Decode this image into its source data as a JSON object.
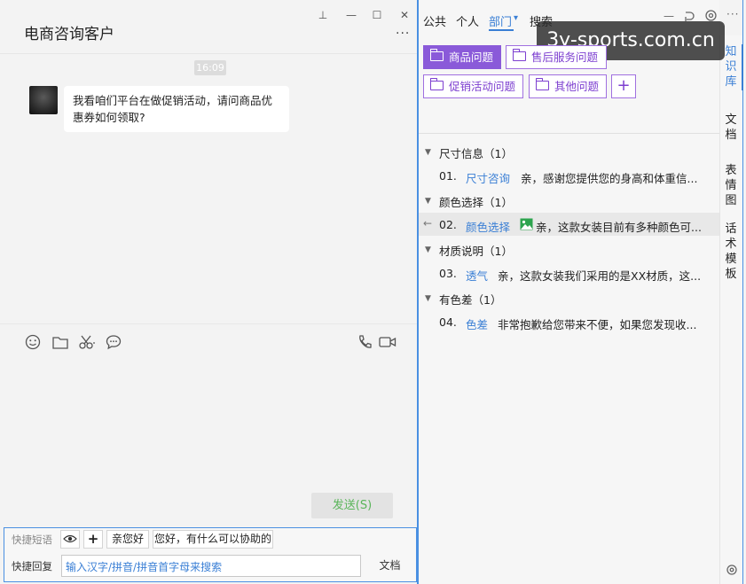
{
  "chat": {
    "title": "电商咨询客户",
    "more": "···",
    "window_buttons": {
      "pin": "⊥",
      "minimize": "—",
      "maximize": "☐",
      "close": "✕"
    },
    "time": "16:09",
    "message": "我看咱们平台在做促销活动，请问商品优惠券如何领取?",
    "toolbar_icons": [
      "emoji-icon",
      "folder-icon",
      "scissors-icon",
      "chat-bubble-icon",
      "phone-icon",
      "video-icon"
    ],
    "send_label": "发送(S)"
  },
  "quick": {
    "phrase_label": "快捷短语",
    "reply_label": "快捷回复",
    "chip_hello": "亲您好",
    "chip_help": "您好，有什么可以协助的",
    "add": "+",
    "input_placeholder": "输入汉字/拼音/拼音首字母来搜索",
    "doc_button": "文档"
  },
  "knowledge": {
    "tabs": [
      "公共",
      "个人",
      "部门",
      "搜索"
    ],
    "dept_arrow": "▾",
    "watermark": "3y-sports.com.cn",
    "categories": [
      "商品问题",
      "售后服务问题",
      "促销活动问题",
      "其他问题"
    ],
    "add": "+",
    "groups": [
      {
        "title": "尺寸信息（1）",
        "num": "01.",
        "tag": "尺寸咨询",
        "answer": "亲，感谢您提供您的身高和体重信..."
      },
      {
        "title": "颜色选择（1）",
        "num": "02.",
        "tag": "颜色选择",
        "answer": "亲，这款女装目前有多种颜色可..."
      },
      {
        "title": "材质说明（1）",
        "num": "03.",
        "tag": "透气",
        "answer": "亲，这款女装我们采用的是XX材质，这..."
      },
      {
        "title": "有色差（1）",
        "num": "04.",
        "tag": "色差",
        "answer": "非常抱歉给您带来不便，如果您发现收..."
      }
    ],
    "back_arrow": "←",
    "side_tabs": [
      "知识库",
      "文档",
      "表情图",
      "话术模板"
    ]
  },
  "colors": {
    "accent": "#3a7fd5",
    "category": "#8a5ad9",
    "send_text": "#5ab55a"
  }
}
